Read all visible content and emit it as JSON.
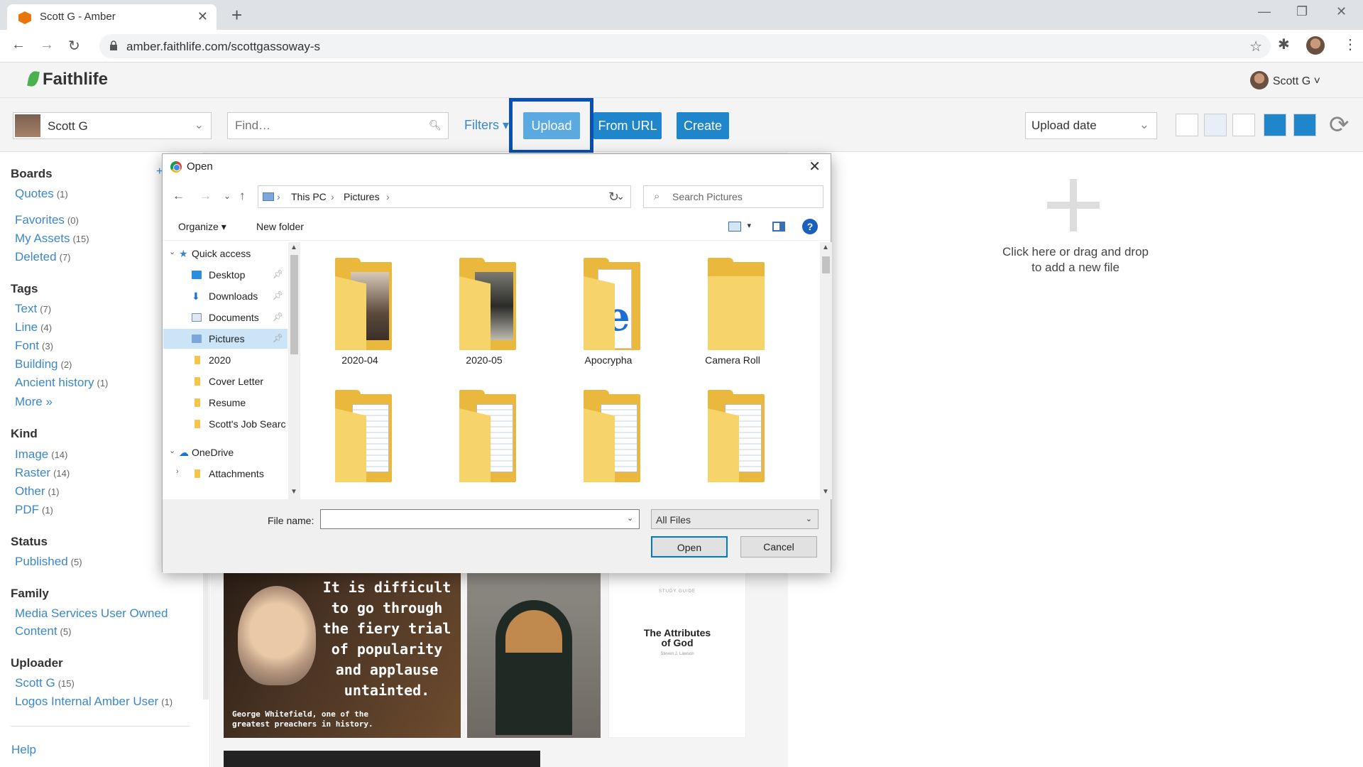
{
  "browser": {
    "tab_title": "Scott G - Amber",
    "url": "amber.faithlife.com/scottgassoway-s"
  },
  "header": {
    "logo": "Faithlife",
    "user": "Scott G ˅"
  },
  "toolbar": {
    "user_select": "Scott G",
    "find_placeholder": "Find…",
    "filters": "Filters ▾",
    "upload": "Upload",
    "from_url": "From URL",
    "create": "Create",
    "sort": "Upload date"
  },
  "sidebar": {
    "boards_heading": "Boards",
    "boards": [
      {
        "label": "Quotes",
        "count": "(1)"
      },
      {
        "label": "Favorites",
        "count": "(0)"
      },
      {
        "label": "My Assets",
        "count": "(15)"
      },
      {
        "label": "Deleted",
        "count": "(7)"
      }
    ],
    "tags_heading": "Tags",
    "tags": [
      {
        "label": "Text",
        "count": "(7)"
      },
      {
        "label": "Line",
        "count": "(4)"
      },
      {
        "label": "Font",
        "count": "(3)"
      },
      {
        "label": "Building",
        "count": "(2)"
      },
      {
        "label": "Ancient history",
        "count": "(1)"
      }
    ],
    "more": "More »",
    "kind_heading": "Kind",
    "kinds": [
      {
        "label": "Image",
        "count": "(14)"
      },
      {
        "label": "Raster",
        "count": "(14)"
      },
      {
        "label": "Other",
        "count": "(1)"
      },
      {
        "label": "PDF",
        "count": "(1)"
      }
    ],
    "status_heading": "Status",
    "statuses": [
      {
        "label": "Published",
        "count": "(5)"
      }
    ],
    "family_heading": "Family",
    "family_line1": "Media Services User Owned",
    "family_line2": "Content",
    "family_count": "(5)",
    "uploader_heading": "Uploader",
    "uploaders": [
      {
        "label": "Scott G",
        "count": "(15)"
      },
      {
        "label": "Logos Internal Amber User",
        "count": "(1)"
      }
    ],
    "help": "Help"
  },
  "main": {
    "drop_line1": "Click here or drag and drop",
    "drop_line2": "to add a new file",
    "quote_text": "It is difficult to go through the fiery trial of popularity and applause untainted.",
    "quote_caption_1": "George Whitefield, one of the",
    "quote_caption_2": "greatest preachers in history.",
    "study_guide_label": "STUDY GUIDE",
    "study_title_1": "The Attributes",
    "study_title_2": "of God",
    "study_author": "Steven J. Lawson"
  },
  "dialog": {
    "title": "Open",
    "breadcrumb": [
      "This PC",
      "Pictures"
    ],
    "search_placeholder": "Search Pictures",
    "organize": "Organize ▾",
    "new_folder": "New folder",
    "tree": [
      {
        "label": "Quick access"
      },
      {
        "label": "Desktop"
      },
      {
        "label": "Downloads"
      },
      {
        "label": "Documents"
      },
      {
        "label": "Pictures"
      },
      {
        "label": "2020"
      },
      {
        "label": "Cover Letter"
      },
      {
        "label": "Resume"
      },
      {
        "label": "Scott's Job Searc"
      },
      {
        "label": "OneDrive"
      },
      {
        "label": "Attachments"
      }
    ],
    "folders": [
      {
        "label": "2020-04"
      },
      {
        "label": "2020-05"
      },
      {
        "label": "Apocrypha"
      },
      {
        "label": "Camera Roll"
      }
    ],
    "file_name_label": "File name:",
    "file_name_value": "",
    "file_type": "All Files",
    "open_button": "Open",
    "cancel_button": "Cancel"
  }
}
